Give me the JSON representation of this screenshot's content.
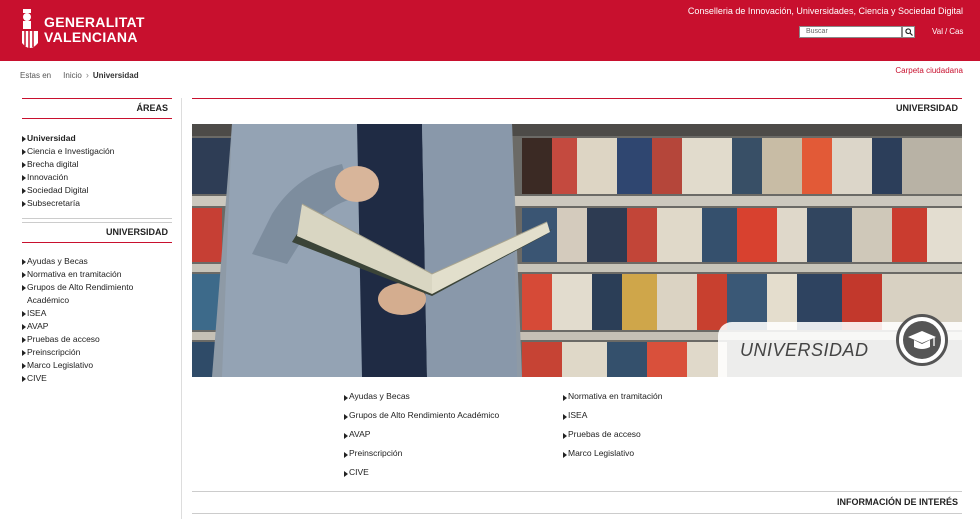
{
  "header": {
    "logo_line1": "GENERALITAT",
    "logo_line2": "VALENCIANA",
    "conselleria": "Conselleria de Innovación, Universidades, Ciencia y Sociedad Digital",
    "search_placeholder": "Buscar",
    "lang_val": "Val",
    "lang_sep": "/",
    "lang_cas": "Cas",
    "brand_color": "#c8102e"
  },
  "breadcrumb": {
    "prefix": "Estas en",
    "home": "Inicio",
    "current": "Universidad"
  },
  "carpeta": "Carpeta ciudadana",
  "sidebar": {
    "areas_title": "ÁREAS",
    "areas": [
      {
        "label": "Universidad"
      },
      {
        "label": "Ciencia e Investigación"
      },
      {
        "label": "Brecha digital"
      },
      {
        "label": "Innovación"
      },
      {
        "label": "Sociedad Digital"
      },
      {
        "label": "Subsecretaría"
      }
    ],
    "section_title": "UNIVERSIDAD",
    "section_items": [
      {
        "label": "Ayudas y Becas"
      },
      {
        "label": "Normativa en tramitación"
      },
      {
        "label": "Grupos de Alto Rendimiento Académico"
      },
      {
        "label": "ISEA"
      },
      {
        "label": "AVAP"
      },
      {
        "label": "Pruebas de acceso"
      },
      {
        "label": "Preinscripción"
      },
      {
        "label": "Marco Legislativo"
      },
      {
        "label": "CIVE"
      }
    ]
  },
  "main": {
    "title": "UNIVERSIDAD",
    "hero_label": "UNIVERSIDAD",
    "hero_badge_icon": "graduation-cap-icon",
    "links": [
      {
        "label": "Ayudas y Becas"
      },
      {
        "label": "Normativa en tramitación"
      },
      {
        "label": "Grupos de Alto Rendimiento Académico"
      },
      {
        "label": "ISEA"
      },
      {
        "label": "AVAP"
      },
      {
        "label": "Pruebas de acceso"
      },
      {
        "label": "Preinscripción"
      },
      {
        "label": "Marco Legislativo"
      },
      {
        "label": "CIVE"
      }
    ],
    "info_title": "INFORMACIÓN DE INTERÉS"
  }
}
